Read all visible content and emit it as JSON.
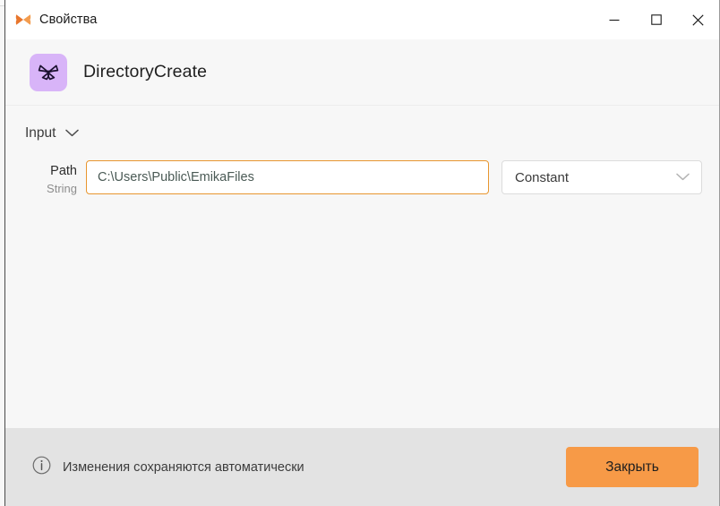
{
  "window": {
    "title": "Свойства",
    "app_icon": "butterfly-icon",
    "controls": {
      "minimize": "minimize-icon",
      "maximize": "maximize-icon",
      "close": "close-icon"
    }
  },
  "activity": {
    "icon": "butterfly-outline-icon",
    "icon_bg": "#d8b4f8",
    "name": "DirectoryCreate"
  },
  "sections": {
    "input": {
      "label": "Input",
      "chevron": "chevron-down-icon",
      "expanded": true
    }
  },
  "fields": [
    {
      "name": "Path",
      "type": "String",
      "value": "C:\\Users\\Public\\EmikaFiles",
      "placeholder": "",
      "mode": "Constant",
      "mode_chevron": "chevron-down-icon",
      "focused": true
    }
  ],
  "footer": {
    "info_icon": "info-circle-icon",
    "message": "Изменения сохраняются автоматически",
    "close_label": "Закрыть"
  },
  "colors": {
    "accent": "#f79a47",
    "focus_border": "#e8962f",
    "icon_purple": "#d8b4f8",
    "titlebar_bg": "#ffffff",
    "body_bg": "#f7f7f7",
    "footer_bg": "#e3e3e3"
  }
}
